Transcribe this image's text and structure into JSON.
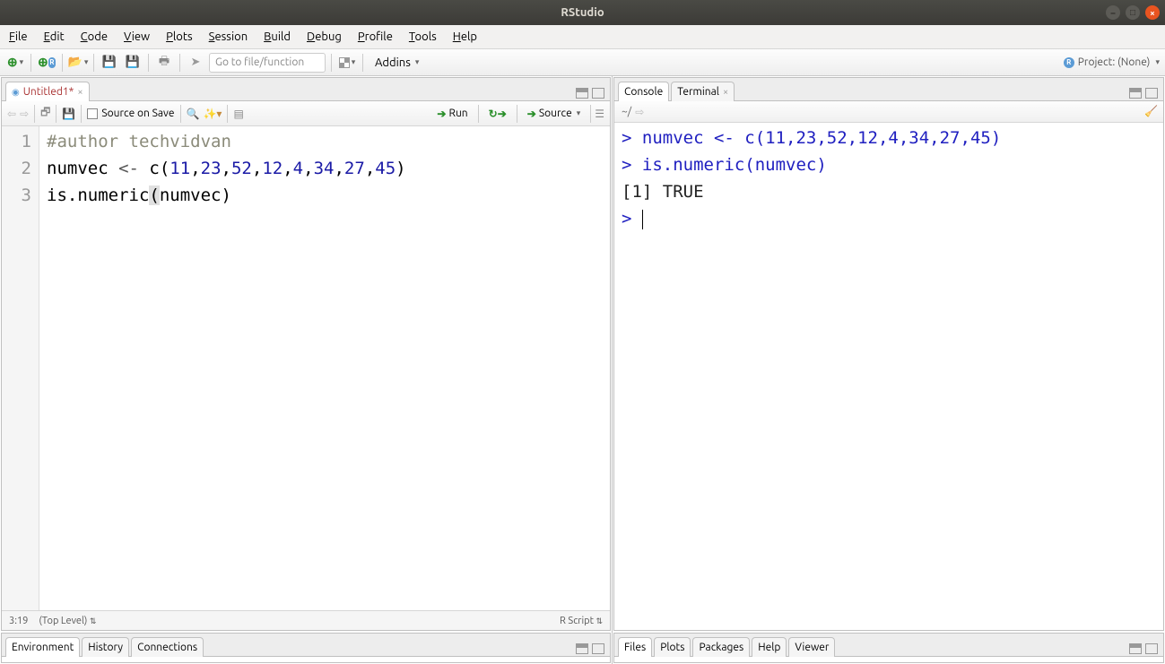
{
  "title": "RStudio",
  "menu": [
    "File",
    "Edit",
    "Code",
    "View",
    "Plots",
    "Session",
    "Build",
    "Debug",
    "Profile",
    "Tools",
    "Help"
  ],
  "toolbar": {
    "goto_placeholder": "Go to file/function",
    "addins": "Addins",
    "project": "Project: (None)"
  },
  "editor": {
    "tab_name": "Untitled1*",
    "source_on_save": "Source on Save",
    "run": "Run",
    "source": "Source",
    "lines": [
      {
        "n": "1",
        "type": "comment",
        "text": "#author techvidvan"
      },
      {
        "n": "2",
        "type": "code",
        "raw": "numvec <- c(11,23,52,12,4,34,27,45)"
      },
      {
        "n": "3",
        "type": "code",
        "raw": "is.numeric(numvec)"
      }
    ],
    "cursor_pos": "3:19",
    "scope": "(Top Level)",
    "lang": "R Script"
  },
  "console": {
    "tabs": [
      "Console",
      "Terminal"
    ],
    "wd": "~/",
    "lines": [
      {
        "prompt": ">",
        "text": "numvec <- c(11,23,52,12,4,34,27,45)",
        "type": "in"
      },
      {
        "prompt": ">",
        "text": "is.numeric(numvec)",
        "type": "in"
      },
      {
        "prompt": "",
        "text": "[1] TRUE",
        "type": "out"
      },
      {
        "prompt": ">",
        "text": "",
        "type": "in",
        "cursor": true
      }
    ]
  },
  "bottom_left_tabs": [
    "Environment",
    "History",
    "Connections"
  ],
  "bottom_right_tabs": [
    "Files",
    "Plots",
    "Packages",
    "Help",
    "Viewer"
  ]
}
